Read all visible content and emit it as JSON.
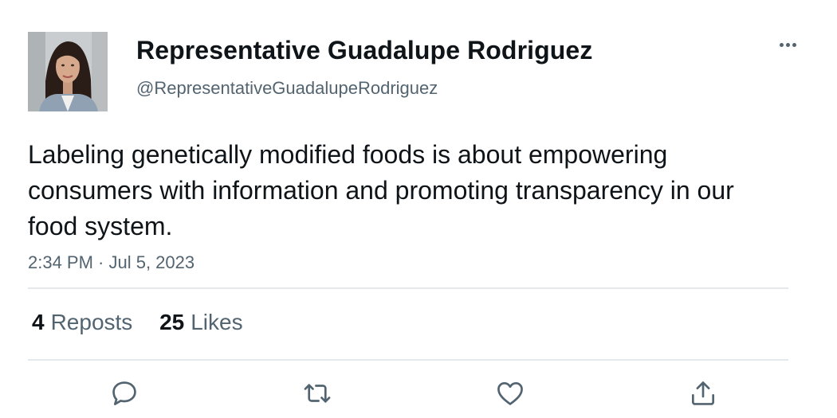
{
  "tweet": {
    "author": {
      "display_name": "Representative Guadalupe Rodriguez",
      "handle": "@RepresentativeGuadalupeRodriguez",
      "avatar_icon": "profile-photo"
    },
    "text": "Labeling genetically modified foods is about empowering consumers with information and promoting transparency in our food system.",
    "timestamp": "2:34 PM · Jul 5, 2023",
    "stats": {
      "reposts_count": "4",
      "reposts_label": "Reposts",
      "likes_count": "25",
      "likes_label": "Likes"
    },
    "actions": [
      {
        "icon": "reply-icon"
      },
      {
        "icon": "repost-icon"
      },
      {
        "icon": "like-icon"
      },
      {
        "icon": "share-icon"
      }
    ],
    "more_icon": "more-icon"
  },
  "colors": {
    "text_primary": "#0f1419",
    "text_secondary": "#536471",
    "divider": "#e6e9eb",
    "background": "#ffffff"
  }
}
